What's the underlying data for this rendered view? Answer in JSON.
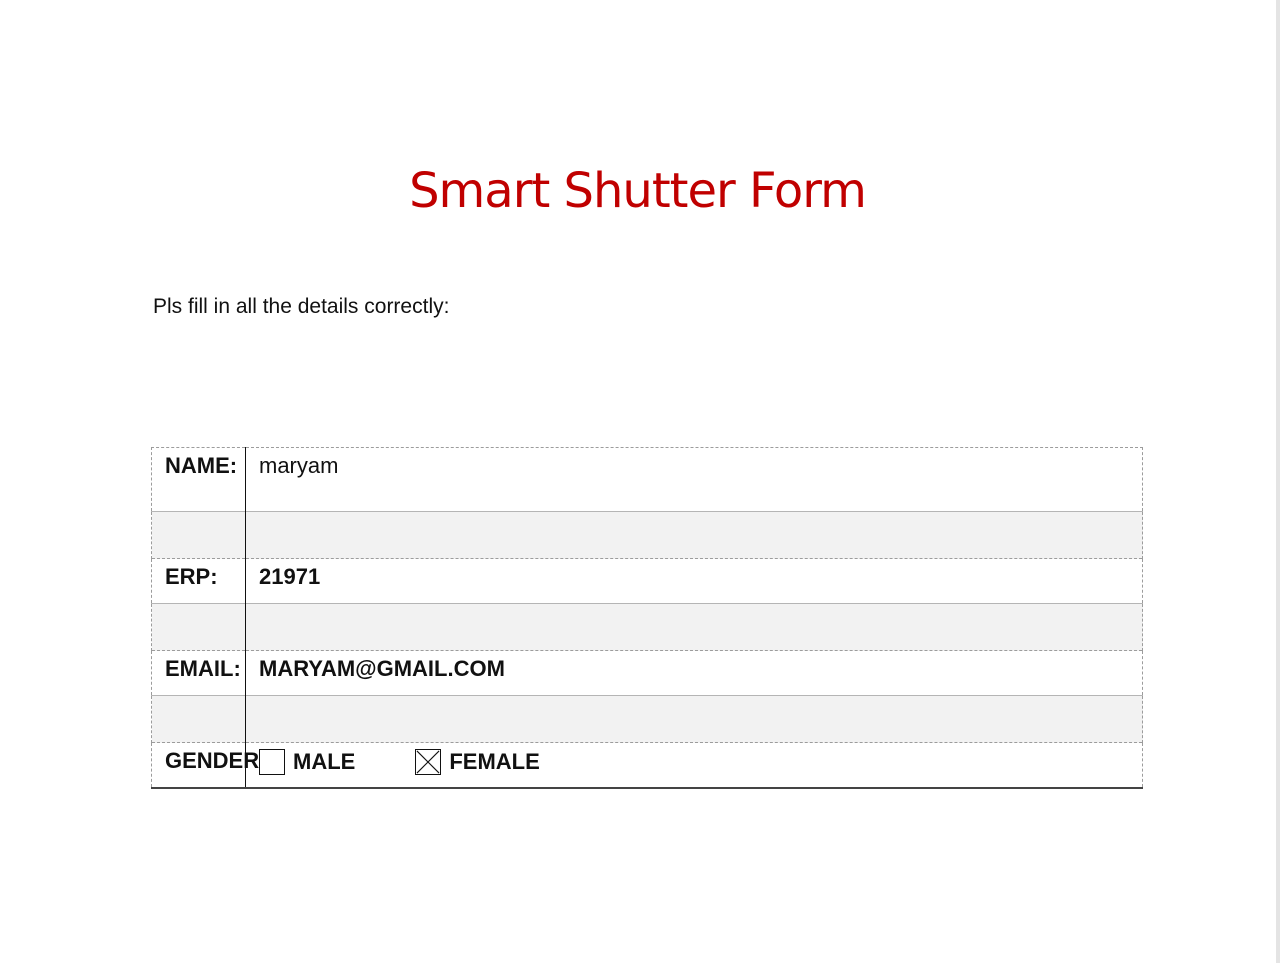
{
  "document": {
    "title": "Smart Shutter Form",
    "instructions": "Pls fill in all the details correctly:"
  },
  "form": {
    "name": {
      "label": "NAME:",
      "value": "maryam"
    },
    "erp": {
      "label": "ERP:",
      "value": "21971"
    },
    "email": {
      "label": "EMAIL:",
      "value": "MARYAM@GMAIL.COM"
    },
    "gender": {
      "label": "GENDER:",
      "options": [
        {
          "label": "MALE",
          "checked": false
        },
        {
          "label": "FEMALE",
          "checked": true
        }
      ]
    }
  },
  "colors": {
    "title": "#c00000",
    "spacer_row": "#f2f2f2"
  }
}
